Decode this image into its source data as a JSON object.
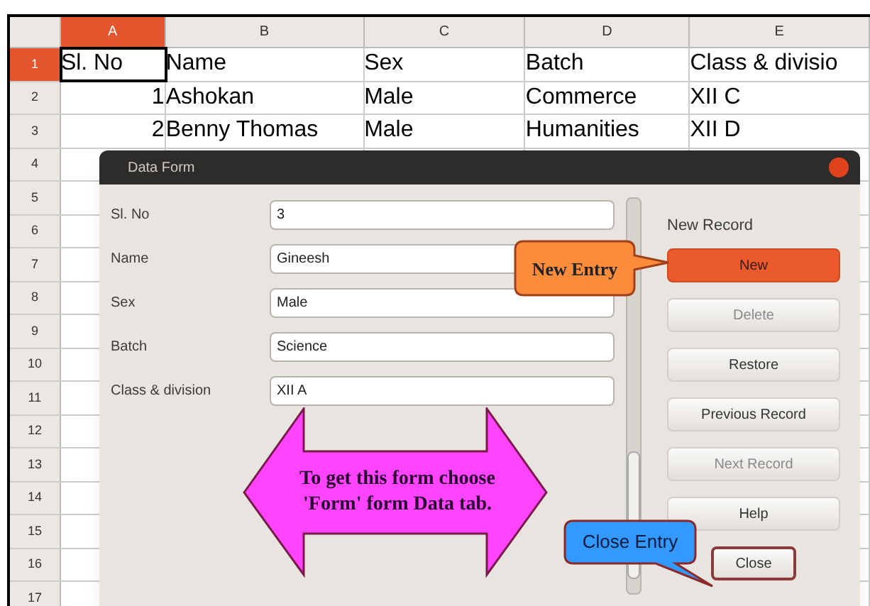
{
  "sheet": {
    "columns": [
      {
        "label": "A",
        "selected": true
      },
      {
        "label": "B",
        "selected": false
      },
      {
        "label": "C",
        "selected": false
      },
      {
        "label": "D",
        "selected": false
      },
      {
        "label": "E",
        "selected": false
      }
    ],
    "rows": [
      {
        "number": "1",
        "selected": true,
        "cells": [
          "Sl. No",
          "Name",
          "Sex",
          "Batch",
          "Class & divisio"
        ]
      },
      {
        "number": "2",
        "selected": false,
        "cells": [
          "1",
          "Ashokan",
          "Male",
          "Commerce",
          "XII C"
        ]
      },
      {
        "number": "3",
        "selected": false,
        "cells": [
          "2",
          "Benny Thomas",
          "Male",
          "Humanities",
          "XII D"
        ]
      },
      {
        "number": "4",
        "selected": false
      },
      {
        "number": "5",
        "selected": false
      },
      {
        "number": "6",
        "selected": false
      },
      {
        "number": "7",
        "selected": false
      },
      {
        "number": "8",
        "selected": false
      },
      {
        "number": "9",
        "selected": false
      },
      {
        "number": "10",
        "selected": false
      },
      {
        "number": "11",
        "selected": false
      },
      {
        "number": "12",
        "selected": false
      },
      {
        "number": "13",
        "selected": false
      },
      {
        "number": "14",
        "selected": false
      },
      {
        "number": "15",
        "selected": false
      },
      {
        "number": "16",
        "selected": false
      },
      {
        "number": "17",
        "selected": false
      }
    ]
  },
  "dialog": {
    "title": "Data Form",
    "fields": [
      {
        "label": "Sl. No",
        "value": "3"
      },
      {
        "label": "Name",
        "value": "Gineesh"
      },
      {
        "label": "Sex",
        "value": "Male"
      },
      {
        "label": "Batch",
        "value": "Science"
      },
      {
        "label": "Class & division",
        "value": "XII A"
      }
    ],
    "record_status": "New Record",
    "buttons": [
      {
        "label": "New",
        "highlighted": true,
        "disabled": false,
        "focused": false
      },
      {
        "label": "Delete",
        "highlighted": false,
        "disabled": true,
        "focused": false
      },
      {
        "label": "Restore",
        "highlighted": false,
        "disabled": false,
        "focused": false
      },
      {
        "label": "Previous Record",
        "highlighted": false,
        "disabled": false,
        "focused": false
      },
      {
        "label": "Next Record",
        "highlighted": false,
        "disabled": true,
        "focused": false
      },
      {
        "label": "Help",
        "highlighted": false,
        "disabled": false,
        "focused": false
      },
      {
        "label": "Close",
        "highlighted": false,
        "disabled": false,
        "focused": true
      }
    ]
  },
  "annotations": [
    {
      "kind": "callout",
      "text": "New Entry",
      "color": "#fb8c3c"
    },
    {
      "kind": "double-arrow",
      "text": "To get this form choose 'Form' form Data tab.",
      "color": "#ff44ff"
    },
    {
      "kind": "callout-down",
      "text": "Close Entry",
      "color": "#3399ff"
    }
  ]
}
